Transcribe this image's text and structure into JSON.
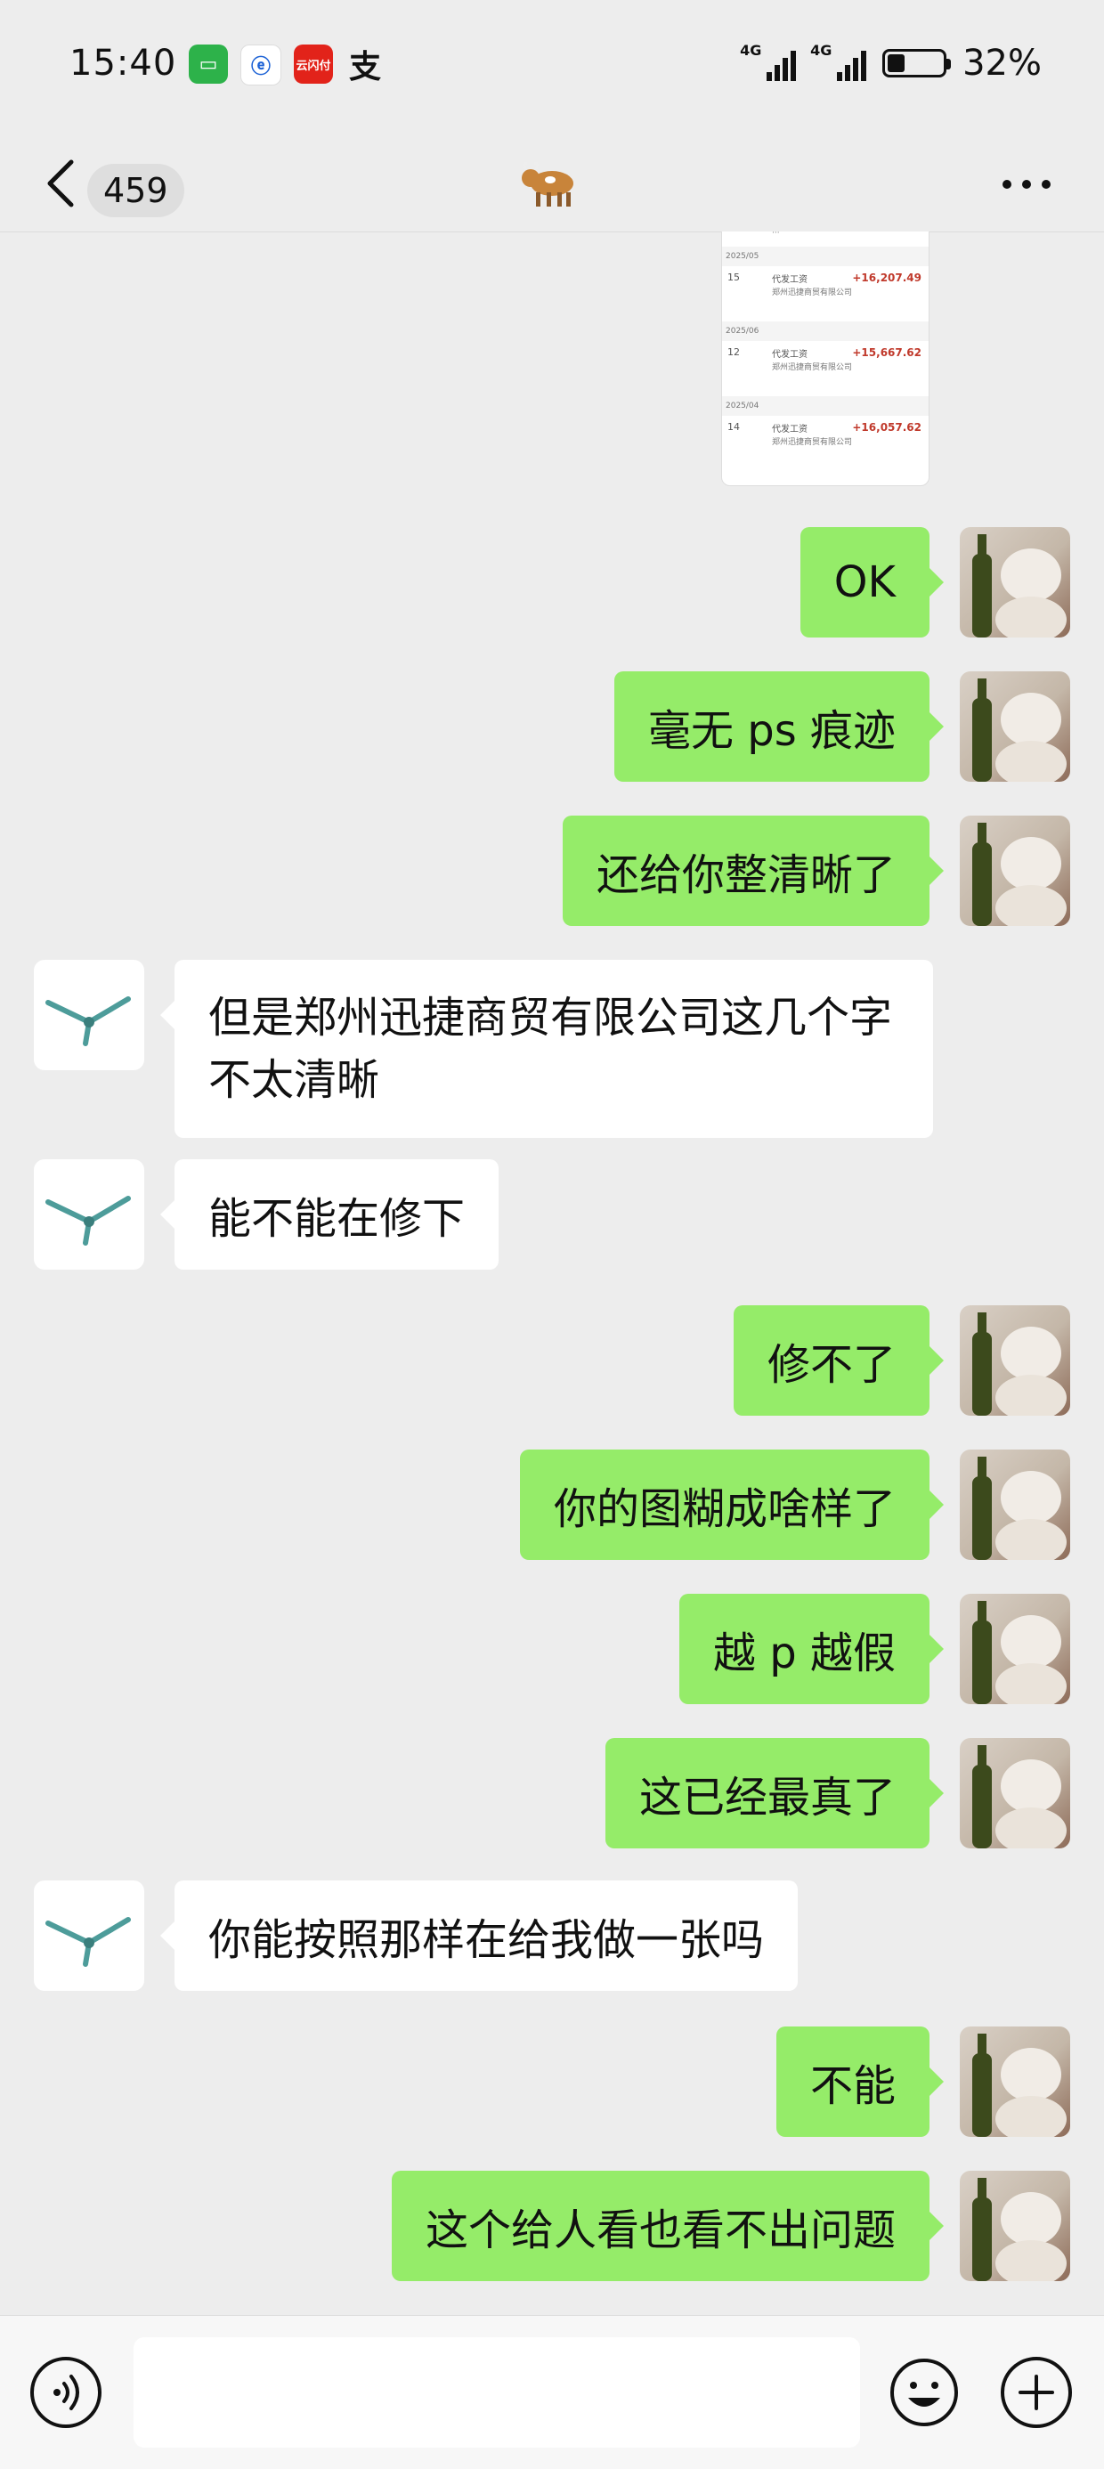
{
  "status_bar": {
    "time": "15:40",
    "apps": [
      {
        "icon": "messages-icon",
        "text": "▭"
      },
      {
        "icon": "china-telecom-icon",
        "text": "ⓔ"
      },
      {
        "icon": "yunshanfu-icon",
        "text": "云闪付"
      },
      {
        "icon": "alipay-icon",
        "text": "支"
      }
    ],
    "signal_1": "4G",
    "signal_2": "4G",
    "battery_level": 0.32,
    "battery_text": "32%"
  },
  "nav": {
    "unread_count": "459",
    "title_icon": "cow-icon"
  },
  "receipt_image": {
    "rows": [
      {
        "month": "2025/05",
        "day": "15",
        "name": "代发工资",
        "amount": "+16,207.49",
        "sub": "郑州迅捷商贸有限公司"
      },
      {
        "month": "2025/06",
        "day": "12",
        "name": "代发工资",
        "amount": "+15,667.62",
        "sub": "郑州迅捷商贸有限公司"
      },
      {
        "month": "2025/04",
        "day": "14",
        "name": "代发工资",
        "amount": "+16,057.62",
        "sub": "郑州迅捷商贸有限公司"
      }
    ]
  },
  "messages": [
    {
      "side": "me",
      "text": "OK"
    },
    {
      "side": "me",
      "text": "毫无 ps 痕迹"
    },
    {
      "side": "me",
      "text": "还给你整清晰了"
    },
    {
      "side": "other",
      "text": "但是郑州迅捷商贸有限公司这几个字不太清晰"
    },
    {
      "side": "other",
      "text": "能不能在修下"
    },
    {
      "side": "me",
      "text": "修不了"
    },
    {
      "side": "me",
      "text": "你的图糊成啥样了"
    },
    {
      "side": "me",
      "text": "越 p 越假"
    },
    {
      "side": "me",
      "text": "这已经最真了"
    },
    {
      "side": "other",
      "text": "你能按照那样在给我做一张吗"
    },
    {
      "side": "me",
      "text": "不能"
    },
    {
      "side": "me",
      "text": "这个给人看也看不出问题"
    }
  ],
  "input": {
    "value": "",
    "placeholder": ""
  },
  "colors": {
    "bubble_me": "#95ec69",
    "bubble_other": "#ffffff",
    "background": "#ededed"
  }
}
